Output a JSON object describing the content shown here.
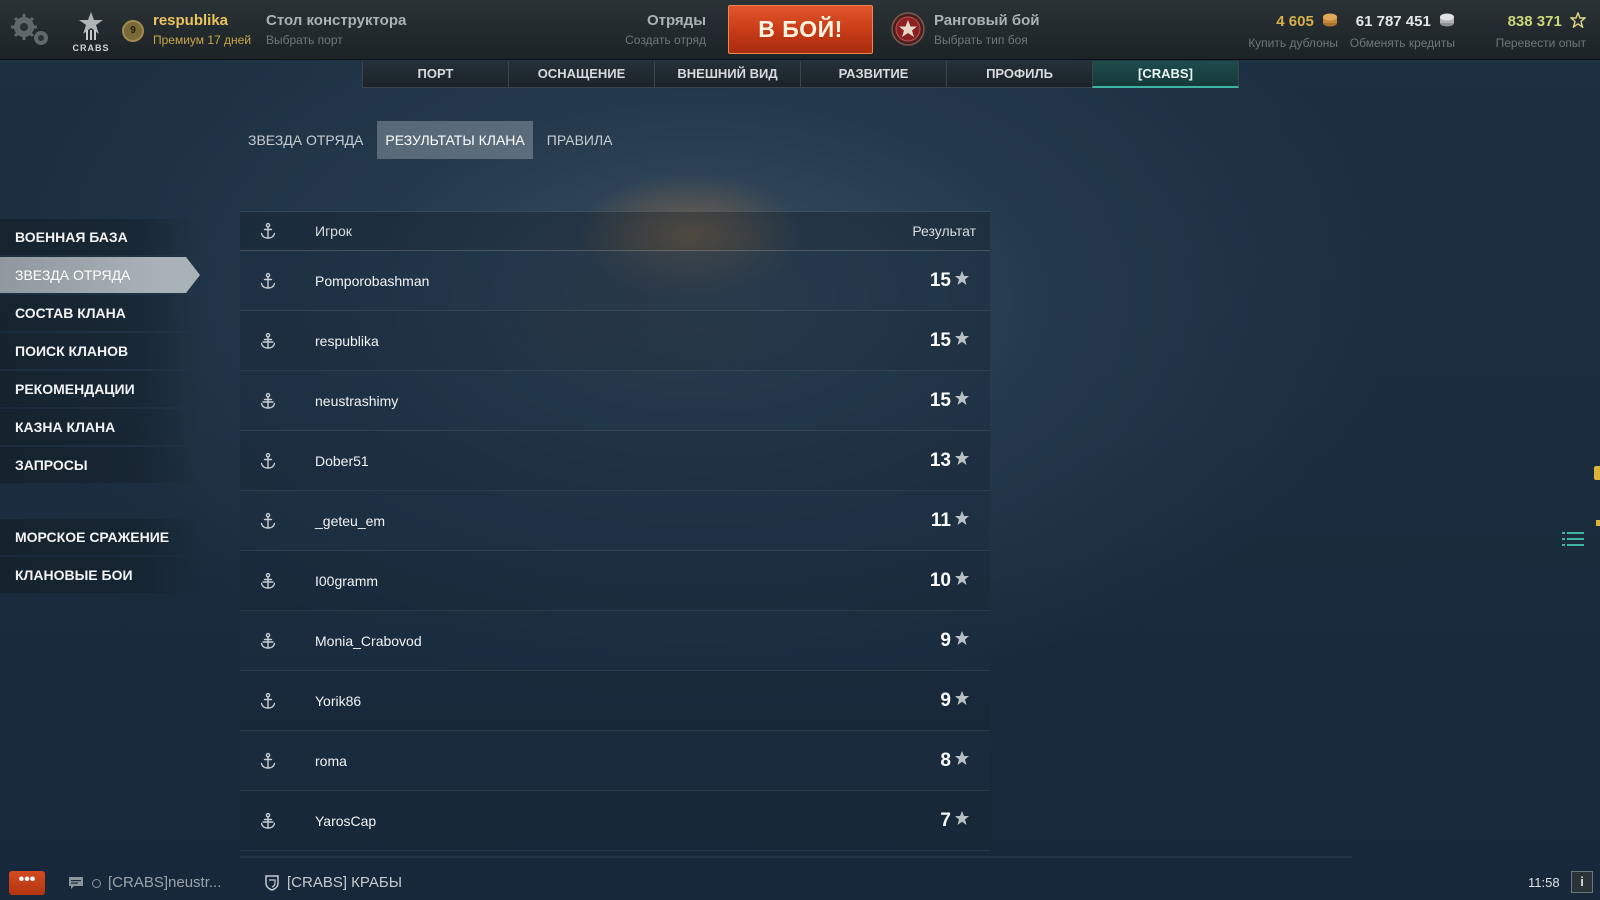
{
  "header": {
    "clan_logo_text": "CRABS",
    "rank_level": "9",
    "player_name": "respublika",
    "premium_text": "Премиум 17 дней",
    "port_title": "Стол конструктора",
    "port_action": "Выбрать порт",
    "division_title": "Отряды",
    "division_action": "Создать отряд",
    "battle_button": "В БОЙ!",
    "mode_title": "Ранговый бой",
    "mode_action": "Выбрать тип боя",
    "currencies": [
      {
        "value": "4 605",
        "action": "Купить дублоны",
        "color": "#d9b04a",
        "icon": "doubloon-icon"
      },
      {
        "value": "61 787 451",
        "action": "Обменять кредиты",
        "color": "#e4e7e8",
        "icon": "credits-icon"
      },
      {
        "value": "838 371",
        "action": "Перевести опыт",
        "color": "#c9d87a",
        "icon": "free-xp-star-icon"
      }
    ]
  },
  "main_tabs": [
    {
      "label": "ПОРТ",
      "active": false
    },
    {
      "label": "ОСНАЩЕНИЕ",
      "active": false
    },
    {
      "label": "ВНЕШНИЙ ВИД",
      "active": false
    },
    {
      "label": "РАЗВИТИЕ",
      "active": false
    },
    {
      "label": "ПРОФИЛЬ",
      "active": false
    },
    {
      "label": "[CRABS]",
      "active": true
    }
  ],
  "sub_tabs": [
    {
      "label": "ЗВЕЗДА ОТРЯДА",
      "active": false
    },
    {
      "label": "РЕЗУЛЬТАТЫ КЛАНА",
      "active": true
    },
    {
      "label": "ПРАВИЛА",
      "active": false
    }
  ],
  "sidebar": {
    "items": [
      {
        "label": "ВОЕННАЯ БАЗА",
        "active": false
      },
      {
        "label": "ЗВЕЗДА ОТРЯДА",
        "active": true
      },
      {
        "label": "СОСТАВ КЛАНА",
        "active": false
      },
      {
        "label": "ПОИСК КЛАНОВ",
        "active": false
      },
      {
        "label": "РЕКОМЕНДАЦИИ",
        "active": false
      },
      {
        "label": "КАЗНА КЛАНА",
        "active": false
      },
      {
        "label": "ЗАПРОСЫ",
        "active": false
      }
    ],
    "items2": [
      {
        "label": "МОРСКОЕ СРАЖЕНИЕ"
      },
      {
        "label": "КЛАНОВЫЕ БОИ"
      }
    ]
  },
  "table": {
    "header_icon": "anchor-icon",
    "col_player": "Игрок",
    "col_result": "Результат",
    "rows": [
      {
        "name": "Pomporobashman",
        "score": "15",
        "role": "officer-anchor-icon"
      },
      {
        "name": "respublika",
        "score": "15",
        "role": "commander-anchor-icon"
      },
      {
        "name": "neustrashimy",
        "score": "15",
        "role": "commander-anchor-icon"
      },
      {
        "name": "Dober51",
        "score": "13",
        "role": "officer-anchor-icon"
      },
      {
        "name": "_geteu_em",
        "score": "11",
        "role": "officer-anchor-icon"
      },
      {
        "name": "I00gramm",
        "score": "10",
        "role": "commander-anchor-icon"
      },
      {
        "name": "Monia_Crabovod",
        "score": "9",
        "role": "commander-anchor-icon"
      },
      {
        "name": "Yorik86",
        "score": "9",
        "role": "officer-anchor-icon"
      },
      {
        "name": "roma",
        "score": "8",
        "role": "officer-anchor-icon"
      },
      {
        "name": "YarosCap",
        "score": "7",
        "role": "commander-anchor-icon"
      }
    ]
  },
  "bottom": {
    "chat_button": "•••",
    "chat_channel": "[CRABS]neustr...",
    "clan_chat": "[CRABS] КРАБЫ",
    "time": "11:58",
    "info": "i"
  }
}
